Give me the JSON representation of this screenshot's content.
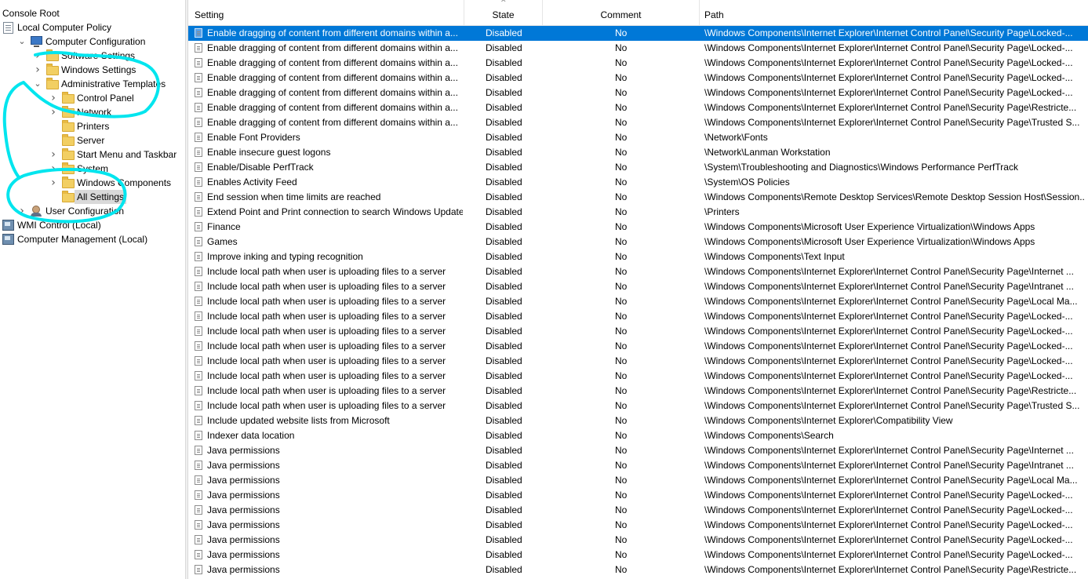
{
  "tree": {
    "items": [
      {
        "label": "Console Root",
        "depth": 0,
        "twisty": "",
        "icon": "none",
        "name": "tree-console-root"
      },
      {
        "label": "Local Computer Policy",
        "depth": 0,
        "twisty": "",
        "icon": "doc",
        "name": "tree-local-computer-policy"
      },
      {
        "label": "Computer Configuration",
        "depth": 1,
        "twisty": "expanded",
        "icon": "pc",
        "name": "tree-computer-configuration"
      },
      {
        "label": "Software Settings",
        "depth": 2,
        "twisty": "collapsed",
        "icon": "folder",
        "name": "tree-software-settings"
      },
      {
        "label": "Windows Settings",
        "depth": 2,
        "twisty": "collapsed",
        "icon": "folder",
        "name": "tree-windows-settings"
      },
      {
        "label": "Administrative Templates",
        "depth": 2,
        "twisty": "expanded",
        "icon": "folder",
        "name": "tree-administrative-templates"
      },
      {
        "label": "Control Panel",
        "depth": 3,
        "twisty": "collapsed",
        "icon": "folder",
        "name": "tree-control-panel"
      },
      {
        "label": "Network",
        "depth": 3,
        "twisty": "collapsed",
        "icon": "folder",
        "name": "tree-network"
      },
      {
        "label": "Printers",
        "depth": 3,
        "twisty": "",
        "icon": "folder",
        "name": "tree-printers"
      },
      {
        "label": "Server",
        "depth": 3,
        "twisty": "",
        "icon": "folder",
        "name": "tree-server"
      },
      {
        "label": "Start Menu and Taskbar",
        "depth": 3,
        "twisty": "collapsed",
        "icon": "folder",
        "name": "tree-start-menu-and-taskbar"
      },
      {
        "label": "System",
        "depth": 3,
        "twisty": "collapsed",
        "icon": "folder",
        "name": "tree-system"
      },
      {
        "label": "Windows Components",
        "depth": 3,
        "twisty": "collapsed",
        "icon": "folder",
        "name": "tree-windows-components"
      },
      {
        "label": "All Settings",
        "depth": 3,
        "twisty": "",
        "icon": "folder",
        "name": "tree-all-settings",
        "selected": true
      },
      {
        "label": "User Configuration",
        "depth": 1,
        "twisty": "collapsed",
        "icon": "user",
        "name": "tree-user-configuration"
      },
      {
        "label": "WMI Control (Local)",
        "depth": 0,
        "twisty": "",
        "icon": "mgmt",
        "name": "tree-wmi-control"
      },
      {
        "label": "Computer Management (Local)",
        "depth": 0,
        "twisty": "",
        "icon": "mgmt",
        "name": "tree-computer-management"
      }
    ]
  },
  "columns": {
    "setting": "Setting",
    "state": "State",
    "comment": "Comment",
    "path": "Path"
  },
  "rows": [
    {
      "setting": "Enable dragging of content from different domains within a...",
      "state": "Disabled",
      "comment": "No",
      "path": "\\Windows Components\\Internet Explorer\\Internet Control Panel\\Security Page\\Locked-...",
      "selected": true
    },
    {
      "setting": "Enable dragging of content from different domains within a...",
      "state": "Disabled",
      "comment": "No",
      "path": "\\Windows Components\\Internet Explorer\\Internet Control Panel\\Security Page\\Locked-..."
    },
    {
      "setting": "Enable dragging of content from different domains within a...",
      "state": "Disabled",
      "comment": "No",
      "path": "\\Windows Components\\Internet Explorer\\Internet Control Panel\\Security Page\\Locked-..."
    },
    {
      "setting": "Enable dragging of content from different domains within a...",
      "state": "Disabled",
      "comment": "No",
      "path": "\\Windows Components\\Internet Explorer\\Internet Control Panel\\Security Page\\Locked-..."
    },
    {
      "setting": "Enable dragging of content from different domains within a...",
      "state": "Disabled",
      "comment": "No",
      "path": "\\Windows Components\\Internet Explorer\\Internet Control Panel\\Security Page\\Locked-..."
    },
    {
      "setting": "Enable dragging of content from different domains within a...",
      "state": "Disabled",
      "comment": "No",
      "path": "\\Windows Components\\Internet Explorer\\Internet Control Panel\\Security Page\\Restricte..."
    },
    {
      "setting": "Enable dragging of content from different domains within a...",
      "state": "Disabled",
      "comment": "No",
      "path": "\\Windows Components\\Internet Explorer\\Internet Control Panel\\Security Page\\Trusted S..."
    },
    {
      "setting": "Enable Font Providers",
      "state": "Disabled",
      "comment": "No",
      "path": "\\Network\\Fonts"
    },
    {
      "setting": "Enable insecure guest logons",
      "state": "Disabled",
      "comment": "No",
      "path": "\\Network\\Lanman Workstation"
    },
    {
      "setting": "Enable/Disable PerfTrack",
      "state": "Disabled",
      "comment": "No",
      "path": "\\System\\Troubleshooting and Diagnostics\\Windows Performance PerfTrack"
    },
    {
      "setting": "Enables Activity Feed",
      "state": "Disabled",
      "comment": "No",
      "path": "\\System\\OS Policies"
    },
    {
      "setting": "End session when time limits are reached",
      "state": "Disabled",
      "comment": "No",
      "path": "\\Windows Components\\Remote Desktop Services\\Remote Desktop Session Host\\Session..."
    },
    {
      "setting": "Extend Point and Print connection to search Windows Update",
      "state": "Disabled",
      "comment": "No",
      "path": "\\Printers"
    },
    {
      "setting": "Finance",
      "state": "Disabled",
      "comment": "No",
      "path": "\\Windows Components\\Microsoft User Experience Virtualization\\Windows Apps"
    },
    {
      "setting": "Games",
      "state": "Disabled",
      "comment": "No",
      "path": "\\Windows Components\\Microsoft User Experience Virtualization\\Windows Apps"
    },
    {
      "setting": "Improve inking and typing recognition",
      "state": "Disabled",
      "comment": "No",
      "path": "\\Windows Components\\Text Input"
    },
    {
      "setting": "Include local path when user is uploading files to a server",
      "state": "Disabled",
      "comment": "No",
      "path": "\\Windows Components\\Internet Explorer\\Internet Control Panel\\Security Page\\Internet ..."
    },
    {
      "setting": "Include local path when user is uploading files to a server",
      "state": "Disabled",
      "comment": "No",
      "path": "\\Windows Components\\Internet Explorer\\Internet Control Panel\\Security Page\\Intranet ..."
    },
    {
      "setting": "Include local path when user is uploading files to a server",
      "state": "Disabled",
      "comment": "No",
      "path": "\\Windows Components\\Internet Explorer\\Internet Control Panel\\Security Page\\Local Ma..."
    },
    {
      "setting": "Include local path when user is uploading files to a server",
      "state": "Disabled",
      "comment": "No",
      "path": "\\Windows Components\\Internet Explorer\\Internet Control Panel\\Security Page\\Locked-..."
    },
    {
      "setting": "Include local path when user is uploading files to a server",
      "state": "Disabled",
      "comment": "No",
      "path": "\\Windows Components\\Internet Explorer\\Internet Control Panel\\Security Page\\Locked-..."
    },
    {
      "setting": "Include local path when user is uploading files to a server",
      "state": "Disabled",
      "comment": "No",
      "path": "\\Windows Components\\Internet Explorer\\Internet Control Panel\\Security Page\\Locked-..."
    },
    {
      "setting": "Include local path when user is uploading files to a server",
      "state": "Disabled",
      "comment": "No",
      "path": "\\Windows Components\\Internet Explorer\\Internet Control Panel\\Security Page\\Locked-..."
    },
    {
      "setting": "Include local path when user is uploading files to a server",
      "state": "Disabled",
      "comment": "No",
      "path": "\\Windows Components\\Internet Explorer\\Internet Control Panel\\Security Page\\Locked-..."
    },
    {
      "setting": "Include local path when user is uploading files to a server",
      "state": "Disabled",
      "comment": "No",
      "path": "\\Windows Components\\Internet Explorer\\Internet Control Panel\\Security Page\\Restricte..."
    },
    {
      "setting": "Include local path when user is uploading files to a server",
      "state": "Disabled",
      "comment": "No",
      "path": "\\Windows Components\\Internet Explorer\\Internet Control Panel\\Security Page\\Trusted S..."
    },
    {
      "setting": "Include updated website lists from Microsoft",
      "state": "Disabled",
      "comment": "No",
      "path": "\\Windows Components\\Internet Explorer\\Compatibility View"
    },
    {
      "setting": "Indexer data location",
      "state": "Disabled",
      "comment": "No",
      "path": "\\Windows Components\\Search"
    },
    {
      "setting": "Java permissions",
      "state": "Disabled",
      "comment": "No",
      "path": "\\Windows Components\\Internet Explorer\\Internet Control Panel\\Security Page\\Internet ..."
    },
    {
      "setting": "Java permissions",
      "state": "Disabled",
      "comment": "No",
      "path": "\\Windows Components\\Internet Explorer\\Internet Control Panel\\Security Page\\Intranet ..."
    },
    {
      "setting": "Java permissions",
      "state": "Disabled",
      "comment": "No",
      "path": "\\Windows Components\\Internet Explorer\\Internet Control Panel\\Security Page\\Local Ma..."
    },
    {
      "setting": "Java permissions",
      "state": "Disabled",
      "comment": "No",
      "path": "\\Windows Components\\Internet Explorer\\Internet Control Panel\\Security Page\\Locked-..."
    },
    {
      "setting": "Java permissions",
      "state": "Disabled",
      "comment": "No",
      "path": "\\Windows Components\\Internet Explorer\\Internet Control Panel\\Security Page\\Locked-..."
    },
    {
      "setting": "Java permissions",
      "state": "Disabled",
      "comment": "No",
      "path": "\\Windows Components\\Internet Explorer\\Internet Control Panel\\Security Page\\Locked-..."
    },
    {
      "setting": "Java permissions",
      "state": "Disabled",
      "comment": "No",
      "path": "\\Windows Components\\Internet Explorer\\Internet Control Panel\\Security Page\\Locked-..."
    },
    {
      "setting": "Java permissions",
      "state": "Disabled",
      "comment": "No",
      "path": "\\Windows Components\\Internet Explorer\\Internet Control Panel\\Security Page\\Locked-..."
    },
    {
      "setting": "Java permissions",
      "state": "Disabled",
      "comment": "No",
      "path": "\\Windows Components\\Internet Explorer\\Internet Control Panel\\Security Page\\Restricte..."
    }
  ],
  "colors": {
    "selection": "#0078d7",
    "annotation": "#00e5ee",
    "tree_selected": "#d9d9d9"
  }
}
